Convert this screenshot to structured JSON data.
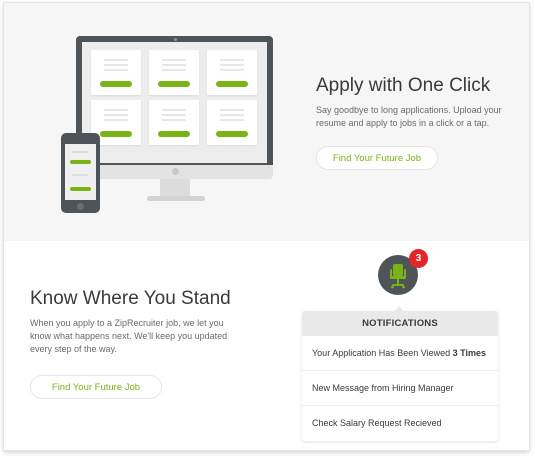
{
  "apply": {
    "title": "Apply with One Click",
    "description": "Say goodbye to long applications. Upload your resume and apply to jobs in a click or a tap.",
    "cta_label": "Find Your Future Job"
  },
  "know": {
    "title": "Know Where You Stand",
    "description": "When you apply to a ZipRecruiter job, we let you know what happens next. We'll keep you updated every step of the way.",
    "cta_label": "Find Your Future Job"
  },
  "notifications": {
    "badge_count": "3",
    "header": "NOTIFICATIONS",
    "items": [
      {
        "text": "Your Application Has Been Viewed ",
        "emphasis": "3 Times"
      },
      {
        "text": "New Message from Hiring Manager",
        "emphasis": ""
      },
      {
        "text": "Check Salary Request Recieved",
        "emphasis": ""
      }
    ]
  },
  "colors": {
    "accent": "#7ab317",
    "badge": "#e4262b",
    "device_dark": "#4f5459"
  },
  "icons": {
    "notification": "office-chair-icon"
  }
}
